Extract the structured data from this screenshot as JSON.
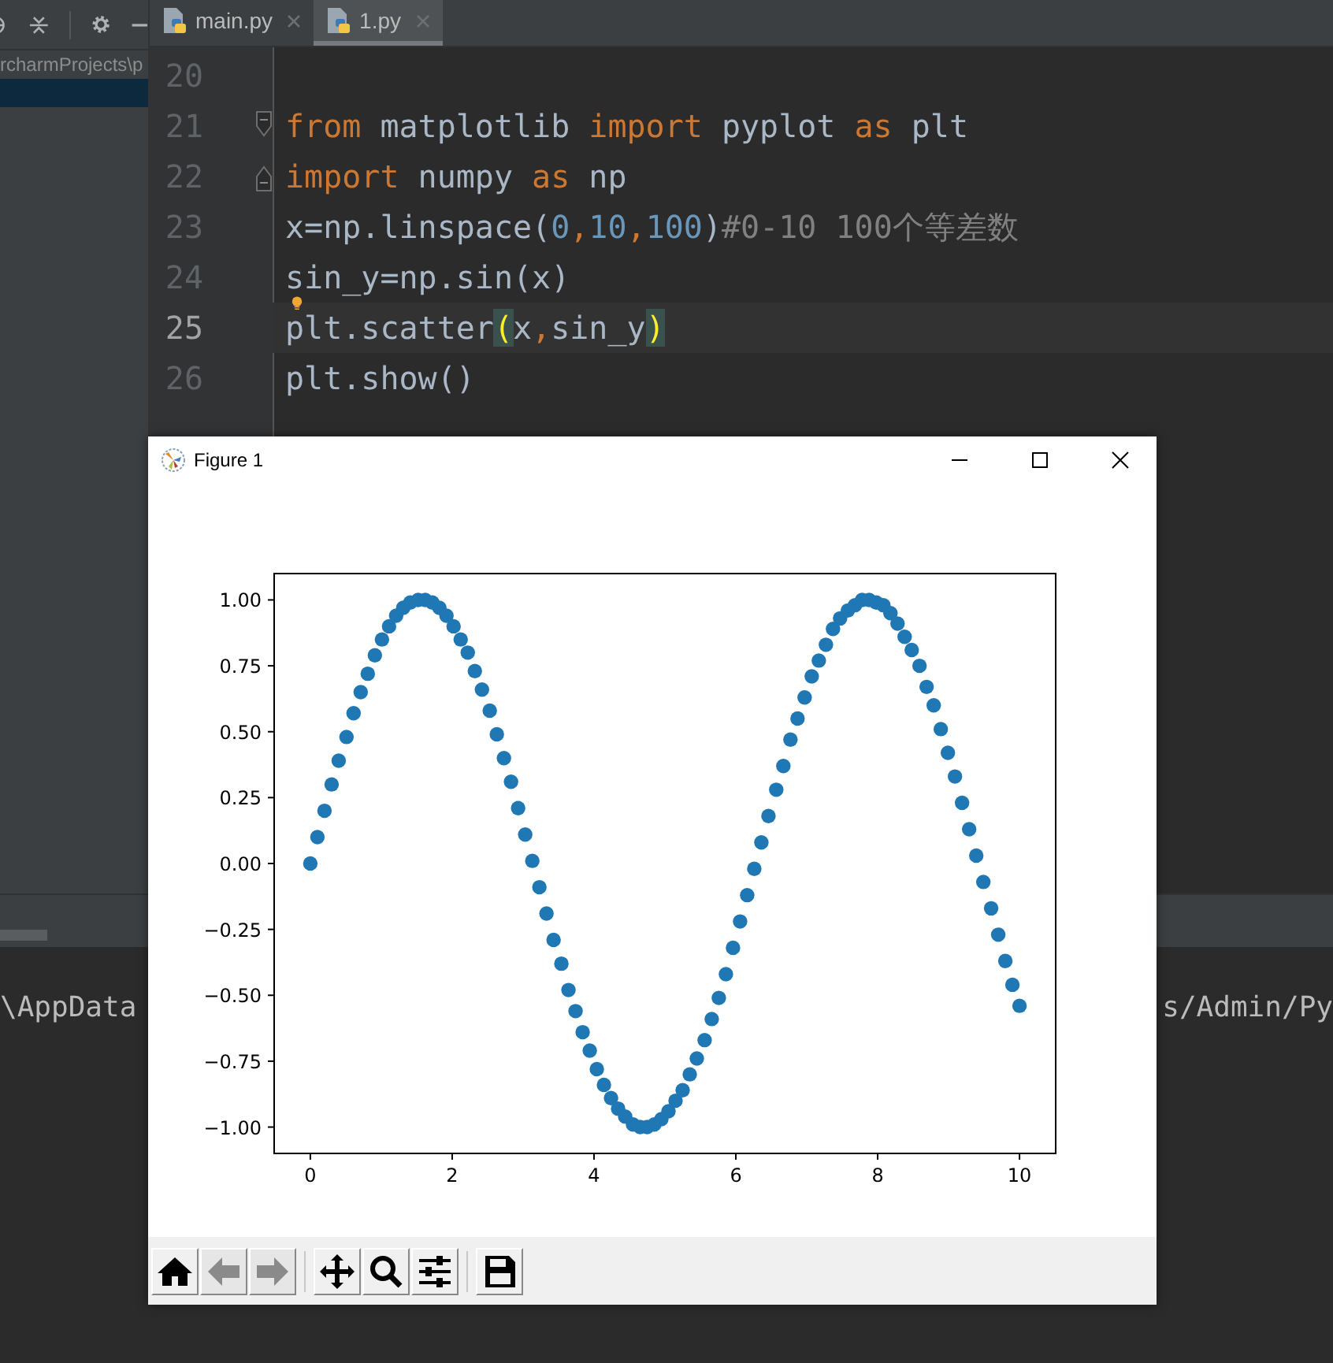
{
  "sidebar": {
    "toolbar": [
      {
        "kind": "target"
      },
      {
        "kind": "collapse"
      },
      {
        "kind": "separator"
      },
      {
        "kind": "settings"
      },
      {
        "kind": "minimize"
      }
    ],
    "rows": [
      {
        "label": "rcharmProjects\\p",
        "selected": false
      },
      {
        "selected": true
      }
    ]
  },
  "editor": {
    "tabs": [
      {
        "label": "main.py",
        "selected": false
      },
      {
        "label": "1.py",
        "selected": true
      }
    ],
    "lines": [
      {
        "number": "20",
        "current": false,
        "hint": false,
        "fold_start": false,
        "fold_end": false
      },
      {
        "number": "21",
        "current": false,
        "hint": false,
        "fold_start": true,
        "fold_end": false,
        "segments": [
          {
            "kind": "kw",
            "text": "from"
          },
          {
            "kind": "id",
            "text": " matplotlib "
          },
          {
            "kind": "kw",
            "text": "import"
          },
          {
            "kind": "id",
            "text": " pyplot "
          },
          {
            "kind": "kw",
            "text": "as"
          },
          {
            "kind": "id",
            "text": " plt"
          }
        ]
      },
      {
        "number": "22",
        "current": false,
        "hint": false,
        "fold_start": false,
        "fold_end": true,
        "segments": [
          {
            "kind": "kw",
            "text": "import"
          },
          {
            "kind": "id",
            "text": " numpy "
          },
          {
            "kind": "kw",
            "text": "as"
          },
          {
            "kind": "id",
            "text": " np"
          }
        ]
      },
      {
        "number": "23",
        "current": false,
        "hint": false,
        "fold_start": false,
        "fold_end": false,
        "segments": [
          {
            "kind": "id",
            "text": "x=np.linspace("
          },
          {
            "kind": "num",
            "text": "0"
          },
          {
            "kind": "punct",
            "text": ","
          },
          {
            "kind": "num",
            "text": "10"
          },
          {
            "kind": "punct",
            "text": ","
          },
          {
            "kind": "num",
            "text": "100"
          },
          {
            "kind": "id",
            "text": ")"
          },
          {
            "kind": "comment",
            "text": "#0-10 100个等差数"
          }
        ]
      },
      {
        "number": "24",
        "current": false,
        "hint": true,
        "fold_start": false,
        "fold_end": false,
        "segments": [
          {
            "kind": "id",
            "text": "sin_y=np.sin(x)"
          }
        ]
      },
      {
        "number": "25",
        "current": true,
        "hint": false,
        "fold_start": false,
        "fold_end": false,
        "segments": [
          {
            "kind": "id",
            "text": "plt.scatter"
          },
          {
            "kind": "bracket",
            "text": "("
          },
          {
            "kind": "id",
            "text": "x"
          },
          {
            "kind": "punct",
            "text": ","
          },
          {
            "kind": "id",
            "text": "sin_y"
          },
          {
            "kind": "bracket",
            "text": ")"
          }
        ]
      },
      {
        "number": "26",
        "current": false,
        "hint": false,
        "fold_start": false,
        "fold_end": false,
        "segments": [
          {
            "kind": "id",
            "text": "plt.show()"
          }
        ]
      }
    ]
  },
  "terminal": {
    "left_text": "\\AppData",
    "right_text": "s/Admin/Py"
  },
  "figure_window": {
    "title": "Figure 1",
    "chart_data": {
      "type": "scatter",
      "x": [
        0,
        0.1,
        0.2,
        0.3,
        0.4,
        0.51,
        0.61,
        0.71,
        0.81,
        0.91,
        1.01,
        1.11,
        1.21,
        1.31,
        1.41,
        1.52,
        1.62,
        1.72,
        1.82,
        1.92,
        2.02,
        2.12,
        2.22,
        2.32,
        2.42,
        2.53,
        2.63,
        2.73,
        2.83,
        2.93,
        3.03,
        3.13,
        3.23,
        3.33,
        3.43,
        3.54,
        3.64,
        3.74,
        3.84,
        3.94,
        4.04,
        4.14,
        4.24,
        4.34,
        4.44,
        4.55,
        4.65,
        4.75,
        4.85,
        4.95,
        5.05,
        5.15,
        5.25,
        5.35,
        5.45,
        5.56,
        5.66,
        5.76,
        5.86,
        5.96,
        6.06,
        6.16,
        6.26,
        6.36,
        6.46,
        6.57,
        6.67,
        6.77,
        6.87,
        6.97,
        7.07,
        7.17,
        7.27,
        7.37,
        7.47,
        7.58,
        7.68,
        7.78,
        7.88,
        7.98,
        8.08,
        8.18,
        8.28,
        8.38,
        8.48,
        8.59,
        8.69,
        8.79,
        8.89,
        8.99,
        9.09,
        9.19,
        9.29,
        9.39,
        9.49,
        9.6,
        9.7,
        9.8,
        9.9,
        10
      ],
      "series": [
        {
          "color": "#1f77b4",
          "values": [
            0,
            0.1,
            0.2,
            0.3,
            0.39,
            0.48,
            0.57,
            0.65,
            0.72,
            0.79,
            0.85,
            0.9,
            0.94,
            0.97,
            0.99,
            1,
            1,
            0.99,
            0.97,
            0.94,
            0.9,
            0.85,
            0.8,
            0.73,
            0.66,
            0.58,
            0.49,
            0.4,
            0.31,
            0.21,
            0.11,
            0.01,
            -0.09,
            -0.19,
            -0.29,
            -0.38,
            -0.48,
            -0.56,
            -0.64,
            -0.71,
            -0.78,
            -0.84,
            -0.89,
            -0.93,
            -0.96,
            -0.99,
            -1,
            -1,
            -0.99,
            -0.97,
            -0.94,
            -0.9,
            -0.86,
            -0.8,
            -0.74,
            -0.67,
            -0.59,
            -0.51,
            -0.42,
            -0.32,
            -0.22,
            -0.12,
            -0.02,
            0.08,
            0.18,
            0.28,
            0.37,
            0.47,
            0.55,
            0.63,
            0.71,
            0.77,
            0.83,
            0.89,
            0.93,
            0.96,
            0.98,
            1,
            1,
            0.99,
            0.98,
            0.95,
            0.91,
            0.86,
            0.81,
            0.75,
            0.67,
            0.6,
            0.51,
            0.42,
            0.33,
            0.23,
            0.13,
            0.03,
            -0.07,
            -0.17,
            -0.27,
            -0.37,
            -0.46,
            -0.54
          ]
        }
      ],
      "xlim": [
        -0.51,
        10.51
      ],
      "ylim": [
        -1.1,
        1.1
      ],
      "xticks": [
        0,
        2,
        4,
        6,
        8,
        10
      ],
      "yticks": [
        {
          "value": 1,
          "label": "1.00"
        },
        {
          "value": 0.75,
          "label": "0.75"
        },
        {
          "value": 0.5,
          "label": "0.50"
        },
        {
          "value": 0.25,
          "label": "0.25"
        },
        {
          "value": 0,
          "label": "0.00"
        },
        {
          "value": -0.25,
          "label": "−0.25"
        },
        {
          "value": -0.5,
          "label": "−0.50"
        },
        {
          "value": -0.75,
          "label": "−0.75"
        },
        {
          "value": -1,
          "label": "−1.00"
        }
      ]
    },
    "toolbar": [
      {
        "buttons": [
          {
            "kind": "home",
            "disabled": false
          },
          {
            "kind": "back",
            "disabled": true
          },
          {
            "kind": "forward",
            "disabled": true
          }
        ]
      },
      {
        "buttons": [
          {
            "kind": "pan",
            "disabled": false
          },
          {
            "kind": "zoom",
            "disabled": false
          },
          {
            "kind": "configure",
            "disabled": false
          }
        ]
      },
      {
        "buttons": [
          {
            "kind": "save",
            "disabled": false
          }
        ]
      }
    ]
  }
}
